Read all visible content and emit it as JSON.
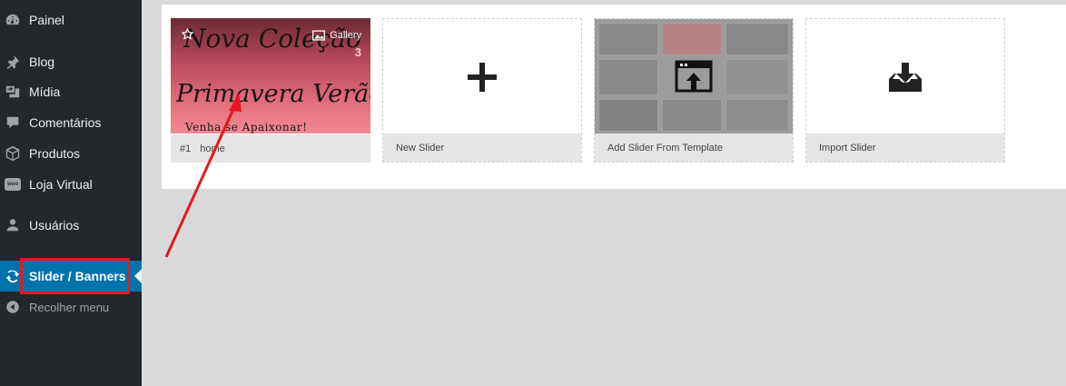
{
  "sidebar": {
    "items": [
      {
        "label": "Painel",
        "icon": "dashboard-icon"
      },
      {
        "label": "Blog",
        "icon": "pin-icon"
      },
      {
        "label": "Mídia",
        "icon": "media-icon"
      },
      {
        "label": "Comentários",
        "icon": "comment-icon"
      },
      {
        "label": "Produtos",
        "icon": "box-icon"
      },
      {
        "label": "Loja Virtual",
        "icon": "woo-icon"
      },
      {
        "label": "Usuários",
        "icon": "user-icon"
      },
      {
        "label": "Slider / Banners",
        "icon": "refresh-icon",
        "active": true
      },
      {
        "label": "Recolher menu",
        "icon": "collapse-icon"
      }
    ],
    "woo_badge": "woo",
    "highlight_color": "#e3191e",
    "active_color": "#0073aa"
  },
  "sliders": [
    {
      "id_label": "#1",
      "name": "home",
      "type_label": "Gallery",
      "count": "3",
      "thumb_text": {
        "line1": "Nova Coleção",
        "line2": "Primavera Verão",
        "line3": "Venha se Apaixonar!"
      }
    }
  ],
  "actions": {
    "new_slider": "New Slider",
    "add_from_template": "Add Slider From Template",
    "import_slider": "Import Slider"
  },
  "annotation": {
    "arrow_color": "#e3191e"
  }
}
